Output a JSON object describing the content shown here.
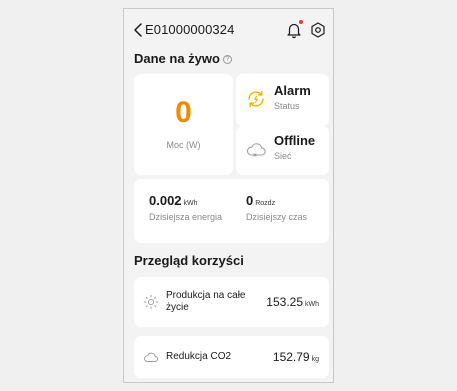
{
  "header": {
    "device_id": "E01000000324",
    "back_icon": "chevron-left-icon",
    "bell_icon": "bell-icon",
    "settings_icon": "hexagon-settings-icon",
    "notification_dot_color": "#e53935"
  },
  "live": {
    "title": "Dane na żywo",
    "info_icon": "info-icon",
    "power": {
      "value": "0",
      "label": "Moc (W)",
      "color": "#f08a00"
    },
    "alarm": {
      "main": "Alarm",
      "sub": "Status",
      "icon": "alarm-sync-icon",
      "icon_color": "#f0b400"
    },
    "network": {
      "main": "Offline",
      "sub": "Sieć",
      "icon": "cloud-offline-icon"
    },
    "energy": {
      "value": "0.002",
      "unit": "kWh",
      "label": "Dzisiejsza energia"
    },
    "time": {
      "value": "0",
      "unit": "Rozdz",
      "label": "Dzisiejszy czas"
    }
  },
  "benefits": {
    "title": "Przegląd korzyści",
    "lifetime": {
      "label": "Produkcja na całe życie",
      "value": "153.25",
      "unit": "kWh",
      "icon": "sun-icon"
    },
    "co2": {
      "label": "Redukcja CO2",
      "value": "152.79",
      "unit": "kg",
      "icon": "cloud-icon"
    }
  }
}
